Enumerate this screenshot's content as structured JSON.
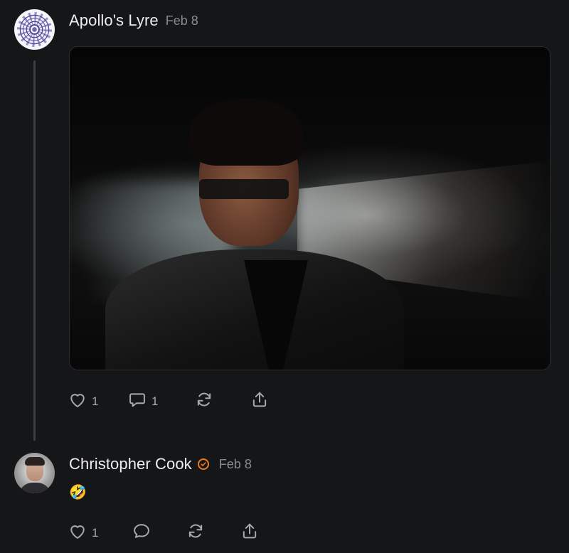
{
  "posts": [
    {
      "author": "Apollo's Lyre",
      "date": "Feb 8",
      "avatar_icon": "mandala-avatar",
      "has_media": true,
      "actions": {
        "likes": "1",
        "comments": "1"
      }
    },
    {
      "author": "Christopher Cook",
      "date": "Feb 8",
      "verified": true,
      "avatar_icon": "person-avatar",
      "body": "🤣",
      "actions": {
        "likes": "1"
      }
    }
  ],
  "colors": {
    "background": "#151618",
    "accent_verified": "#f07a1e",
    "icon": "#a8a9ad"
  }
}
